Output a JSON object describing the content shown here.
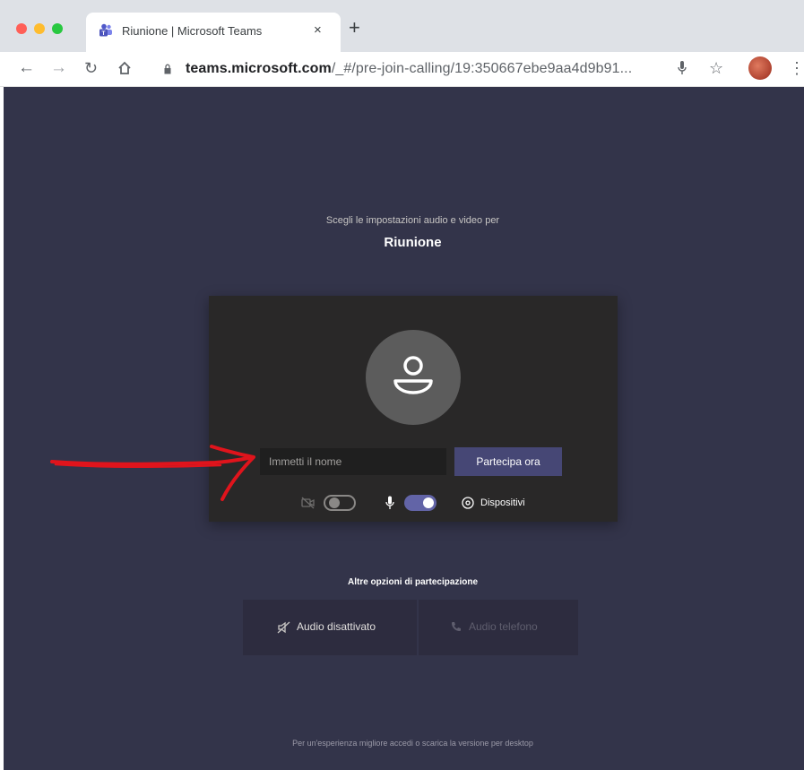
{
  "browser": {
    "tab_title": "Riunione | Microsoft Teams",
    "tab_close": "×",
    "new_tab": "+",
    "url_host": "teams.microsoft.com",
    "url_path": "/_#/pre-join-calling/19:350667ebe9aa4d9b91..."
  },
  "prejoin": {
    "subtitle": "Scegli le impostazioni audio e video per",
    "meeting_title": "Riunione",
    "name_placeholder": "Immetti il nome",
    "join_label": "Partecipa ora",
    "camera_on": false,
    "mic_on": true,
    "devices_label": "Dispositivi"
  },
  "other_options": {
    "heading": "Altre opzioni di partecipazione",
    "audio_off_label": "Audio disattivato",
    "phone_audio_label": "Audio telefono"
  },
  "footer": {
    "text": "Per un'esperienza migliore accedi o scarica la versione per desktop"
  },
  "colors": {
    "page_bg": "#33344a",
    "card_bg": "#292828",
    "accent": "#464775",
    "toggle_on": "#6264a7",
    "annotation_arrow": "#e0141c"
  }
}
